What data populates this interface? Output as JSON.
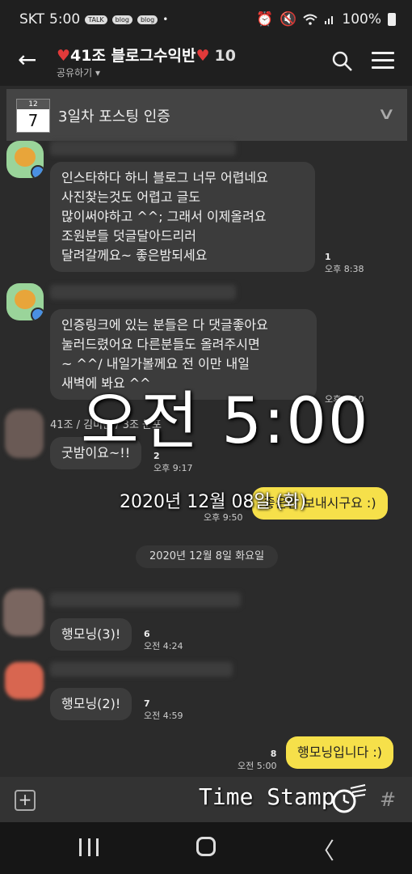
{
  "status_bar": {
    "carrier": "SKT",
    "time": "5:00",
    "notifications": [
      "TALK",
      "blog",
      "blog"
    ],
    "battery": "100%",
    "icons": [
      "alarm-icon",
      "mute-icon",
      "wifi-icon",
      "signal-icon",
      "battery-icon"
    ]
  },
  "header": {
    "title": "41조 블로그수익반",
    "member_count": "10",
    "share_label": "공유하기",
    "icons": [
      "back-arrow-icon",
      "search-icon",
      "menu-icon"
    ]
  },
  "notice": {
    "calendar_month": "12",
    "calendar_day": "7",
    "text": "3일차 포스팅 인증"
  },
  "messages": [
    {
      "text": "인스타하다 하니 블로그 너무 어렵네요\n사진찾는것도 어렵고 글도\n많이써야하고 ^^; 그래서 이제올려요\n조원분들 덧글달아드리러\n달려갈께요~ 좋은밤되세요",
      "unread": "1",
      "time": "오후 8:38"
    },
    {
      "text": "인증링크에 있는 분들은 다 댓글좋아요\n눌러드렸어요 다른분들도 올려주시면\n~ ^^/ 내일가볼께요 전 이만 내일\n새벽에 봐요 ^^",
      "unread": "",
      "time": "오후 9:10"
    },
    {
      "sender": "41조 / 김미은 / 3조 군포",
      "text": "굿밤이요~!!",
      "unread": "2",
      "time": "오후 9:17"
    },
    {
      "text": "좋은밤 보내시구요 :)",
      "time": "오후 9:50",
      "mine": true
    },
    {
      "text": "행모닝(3)!",
      "unread": "6",
      "time": "오전 4:24"
    },
    {
      "text": "행모닝(2)!",
      "unread": "7",
      "time": "오전 4:59"
    },
    {
      "text": "행모닝입니다 :)",
      "unread": "8",
      "time": "오전 5:00",
      "mine": true
    }
  ],
  "date_divider": "2020년 12월 8일 화요일",
  "overlay": {
    "time": "오전 5:00",
    "date": "2020년 12월 08일 (화)"
  },
  "input_bar": {
    "timestamp_label": "Time Stamp",
    "hash": "#"
  },
  "colors": {
    "background": "#2b2b2b",
    "bubble_other": "#3c3c3c",
    "bubble_me": "#f6e04a",
    "heart": "#e23a3a"
  }
}
